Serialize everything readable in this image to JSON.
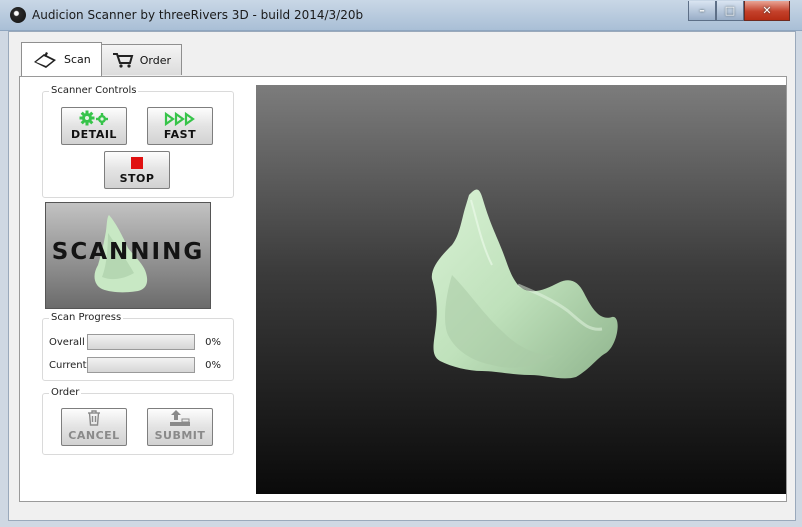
{
  "window": {
    "title": "Audicion Scanner by threeRivers 3D - build 2014/3/20b",
    "controls": [
      "minimize",
      "maximize",
      "close"
    ]
  },
  "tabs": [
    {
      "label": "Scan",
      "icon": "scanner-icon",
      "active": true
    },
    {
      "label": "Order",
      "icon": "cart-icon",
      "active": false
    }
  ],
  "scanner_controls": {
    "title": "Scanner Controls",
    "detail_label": "DETAIL",
    "fast_label": "FAST",
    "stop_label": "STOP"
  },
  "preview": {
    "status_text": "SCANNING"
  },
  "scan_progress": {
    "title": "Scan Progress",
    "overall_label": "Overall",
    "overall_value": "0%",
    "overall_fraction": 0,
    "current_label": "Current",
    "current_value": "0%",
    "current_fraction": 0
  },
  "order": {
    "title": "Order",
    "cancel_label": "CANCEL",
    "submit_label": "SUBMIT"
  },
  "colors": {
    "model": "#c8e8c4",
    "model_shadow": "#86a986",
    "stop": "#e01010",
    "gear": "#37c44a"
  }
}
